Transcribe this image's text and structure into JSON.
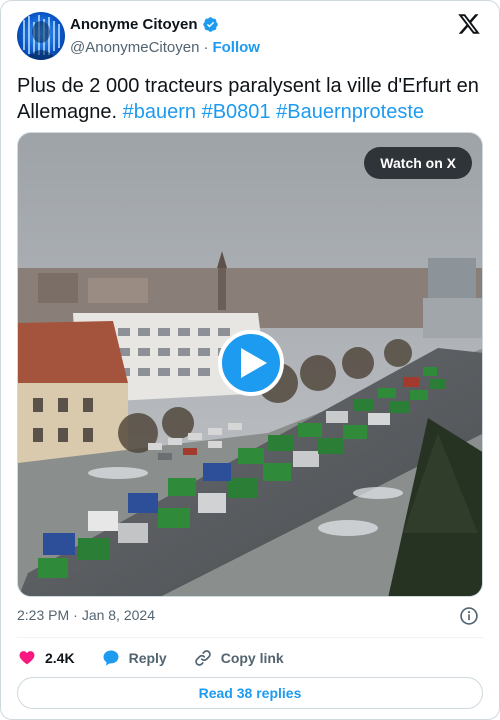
{
  "author": {
    "display_name": "Anonyme Citoyen",
    "handle": "@AnonymeCitoyen",
    "separator": "·",
    "follow_label": "Follow",
    "verified": true
  },
  "tweet": {
    "text": "Plus de 2 000 tracteurs paralysent la ville d'Erfurt en Allemagne.",
    "hashtags": [
      "#bauern",
      "#B0801",
      "#Bauernproteste"
    ]
  },
  "media": {
    "watch_label": "Watch on X",
    "type": "video"
  },
  "meta": {
    "time": "2:23 PM",
    "separator": "·",
    "date": "Jan 8, 2024"
  },
  "actions": {
    "like_count": "2.4K",
    "reply_label": "Reply",
    "copy_link_label": "Copy link"
  },
  "read_replies_label": "Read 38 replies",
  "colors": {
    "accent": "#1d9bf0",
    "like": "#f91880",
    "text_primary": "#0f1419",
    "text_secondary": "#536471",
    "border": "#cfd9de"
  },
  "icons": [
    "verified-badge-icon",
    "x-logo-icon",
    "play-icon",
    "info-icon",
    "heart-icon",
    "reply-bubble-icon",
    "link-icon"
  ]
}
